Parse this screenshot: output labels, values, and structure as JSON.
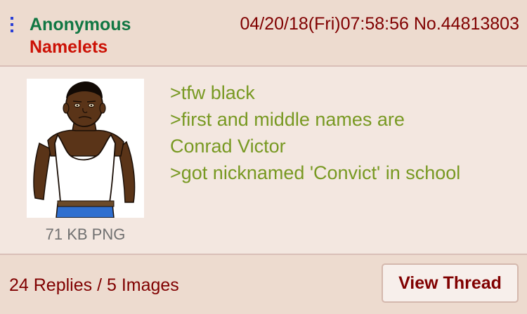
{
  "post": {
    "name": "Anonymous",
    "subject": "Namelets",
    "datetime": "04/20/18(Fri)07:58:56",
    "post_number": "No.44813803",
    "menu_icon": "vertical-dots-icon"
  },
  "file": {
    "info": "71 KB PNG",
    "thumbnail": "cartoon-man-tank-top"
  },
  "message": {
    "lines": [
      ">tfw black",
      ">first and middle names are",
      "Conrad Victor",
      ">got nicknamed 'Convict' in school"
    ]
  },
  "footer": {
    "replies": "24 Replies / 5 Images",
    "view_thread_label": "View Thread"
  },
  "colors": {
    "name": "#117743",
    "subject": "#cc1105",
    "greentext": "#789922",
    "meta": "#800000",
    "background": "#f0e0d6"
  }
}
